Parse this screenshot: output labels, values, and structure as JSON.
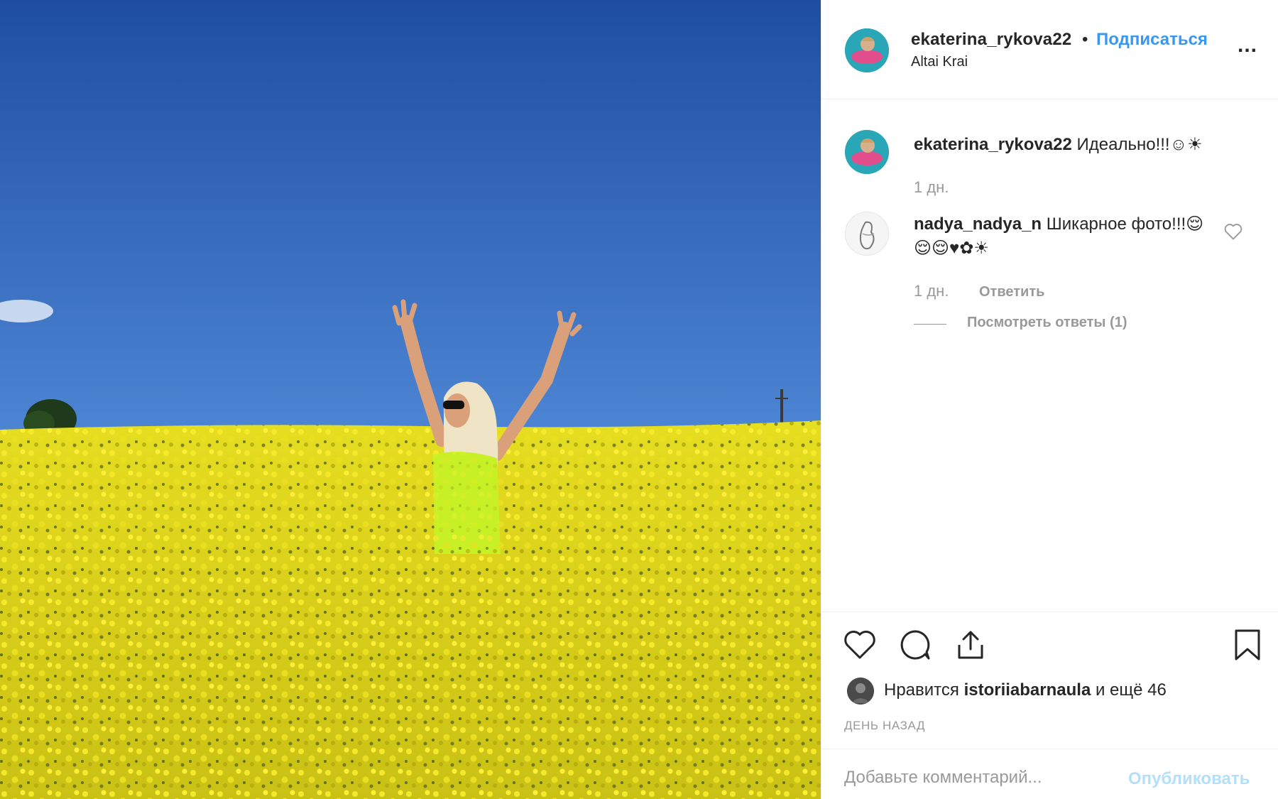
{
  "post": {
    "photo": {
      "description_icon": "photo-icon"
    },
    "header": {
      "username": "ekaterina_rykova22",
      "separator": "•",
      "follow_label": "Подписаться",
      "location": "Altai Krai",
      "more_icon": "more-icon",
      "more_label": "..."
    },
    "comments": [
      {
        "username": "ekaterina_rykova22",
        "text": "Идеально!!!☺☀",
        "time": "1 дн."
      },
      {
        "username": "nadya_nadya_n",
        "text": "Шикарное фото!!!😌😌😌♥✿☀",
        "time": "1 дн.",
        "reply_label": "Ответить",
        "view_replies_label": "Посмотреть ответы (1)"
      }
    ],
    "likes": {
      "prefix": "Нравится",
      "user": "istoriiabarnaula",
      "suffix": "и ещё 46"
    },
    "time_ago": "ДЕНЬ НАЗАД",
    "comment_box": {
      "placeholder": "Добавьте комментарий...",
      "publish_label": "Опубликовать"
    }
  },
  "colors": {
    "link_blue": "#3897f0",
    "publish_disabled": "#b2dffc",
    "muted": "#999999",
    "sky_top": "#1f4ea0",
    "sky_bottom": "#6aa3e2",
    "field_yellow": "#e9de1c"
  }
}
